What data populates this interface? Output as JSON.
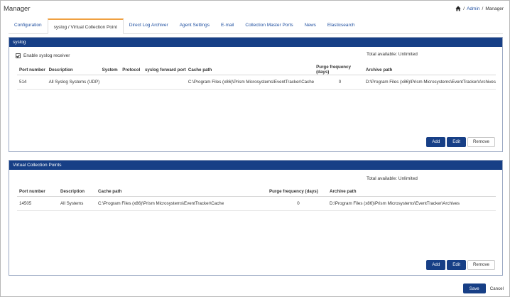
{
  "header": {
    "title": "Manager",
    "breadcrumb": {
      "separator": "/",
      "admin": "Admin",
      "current": "Manager"
    }
  },
  "tabs": [
    {
      "label": "Configuration"
    },
    {
      "label": "syslog / Virtual Collection Point",
      "active": true
    },
    {
      "label": "Direct Log Archiver"
    },
    {
      "label": "Agent Settings"
    },
    {
      "label": "E-mail"
    },
    {
      "label": "Collection Master Ports"
    },
    {
      "label": "News"
    },
    {
      "label": "Elasticsearch"
    }
  ],
  "syslog": {
    "title": "syslog",
    "enable_label": "Enable syslog receiver",
    "enabled": true,
    "total": "Total available: Unlimited",
    "columns": [
      "Port number",
      "Description",
      "System",
      "Protocol",
      "syslog forward port",
      "Cache path",
      "Purge frequency (days)",
      "Archive path"
    ],
    "rows": [
      [
        "514",
        "All Syslog Systems (UDP)",
        "",
        "",
        "",
        "C:\\Program Files (x86)\\Prism Microsystems\\EventTracker\\Cache",
        "0",
        "D:\\Program Files (x86)\\Prism Microsystems\\EventTracker\\Archives"
      ]
    ],
    "buttons": {
      "add": "Add",
      "edit": "Edit",
      "remove": "Remove"
    }
  },
  "vcp": {
    "title": "Virtual Collection Points",
    "total": "Total available: Unlimited",
    "columns": [
      "Port number",
      "Description",
      "Cache path",
      "Purge frequency (days)",
      "Archive path"
    ],
    "rows": [
      [
        "14505",
        "All Systems",
        "C:\\Program Files (x86)\\Prism Microsystems\\EventTracker\\Cache",
        "0",
        "D:\\Program Files (x86)\\Prism Microsystems\\EventTracker\\Archives"
      ]
    ],
    "buttons": {
      "add": "Add",
      "edit": "Edit",
      "remove": "Remove"
    }
  },
  "footer": {
    "save": "Save",
    "cancel": "Cancel"
  },
  "colors": {
    "header_blue": "#173f86",
    "link_blue": "#1f4fa0",
    "active_tab_accent": "#f0a040"
  }
}
